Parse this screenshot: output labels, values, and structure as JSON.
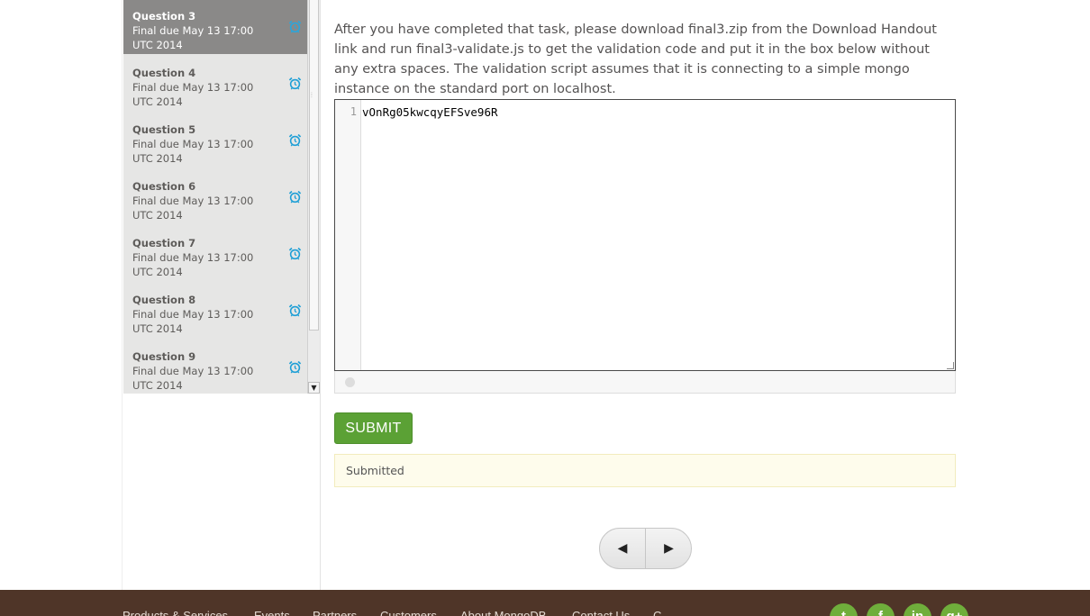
{
  "questions": [
    {
      "title": "Question 3",
      "due": "Final due May 13 17:00 UTC 2014",
      "icon": "alarm-clock-icon",
      "active": true
    },
    {
      "title": "Question 4",
      "due": "Final due May 13 17:00 UTC 2014",
      "icon": "alarm-clock-icon",
      "active": false
    },
    {
      "title": "Question 5",
      "due": "Final due May 13 17:00 UTC 2014",
      "icon": "alarm-clock-icon",
      "active": false
    },
    {
      "title": "Question 6",
      "due": "Final due May 13 17:00 UTC 2014",
      "icon": "alarm-clock-icon",
      "active": false
    },
    {
      "title": "Question 7",
      "due": "Final due May 13 17:00 UTC 2014",
      "icon": "alarm-clock-icon",
      "active": false
    },
    {
      "title": "Question 8",
      "due": "Final due May 13 17:00 UTC 2014",
      "icon": "alarm-clock-icon",
      "active": false
    },
    {
      "title": "Question 9",
      "due": "Final due May 13 17:00 UTC 2014",
      "icon": "alarm-clock-icon",
      "active": false
    }
  ],
  "main": {
    "prompt": "After you have completed that task, please download final3.zip from the Download Handout link and run final3-validate.js to get the validation code and put it in the box below without any extra spaces. The validation script assumes that it is connecting to a simple mongo instance on the standard port on localhost.",
    "editor": {
      "line_number": "1",
      "code": "vOnRg05kwcqyEFSve96R"
    },
    "submit_label": "SUBMIT",
    "status_text": "Submitted",
    "pager": {
      "prev_icon": "◀",
      "next_icon": "▶"
    }
  },
  "footer": {
    "links": [
      "Products & Services",
      "Events",
      "Partners",
      "Customers",
      "About MongoDB",
      "Contact Us",
      "C"
    ],
    "social": [
      {
        "icon": "twitter-icon",
        "glyph": "t"
      },
      {
        "icon": "facebook-icon",
        "glyph": "f"
      },
      {
        "icon": "linkedin-icon",
        "glyph": "in"
      },
      {
        "icon": "google-plus-icon",
        "glyph": "g+"
      }
    ]
  },
  "colors": {
    "accent": "#5ba135",
    "alarm_icon": "#1e9fd6",
    "footer_bg": "#4f3528",
    "active_item_bg": "#8a8988"
  }
}
